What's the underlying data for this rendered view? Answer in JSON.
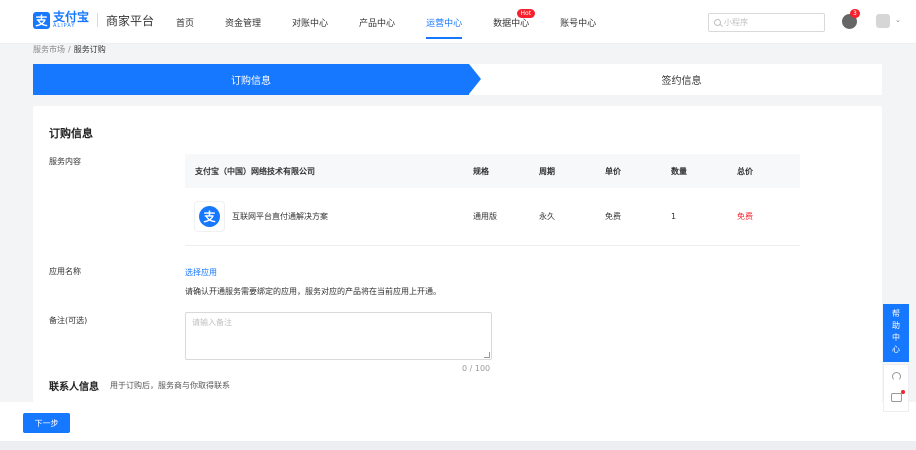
{
  "brand": {
    "logo_glyph": "支",
    "name_cn": "支付宝",
    "name_en": "ALIPAY",
    "platform": "商家平台",
    "accent_color": "#1677ff"
  },
  "nav": {
    "items": [
      {
        "label": "首页"
      },
      {
        "label": "资金管理"
      },
      {
        "label": "对账中心"
      },
      {
        "label": "产品中心"
      },
      {
        "label": "运营中心",
        "active": true
      },
      {
        "label": "数据中心",
        "badge": "Hot"
      },
      {
        "label": "账号中心"
      }
    ]
  },
  "header": {
    "search_placeholder": "小程序",
    "notification_count": "3"
  },
  "breadcrumb": {
    "parent": "服务市场",
    "separator": "/",
    "current": "服务订购"
  },
  "steps": {
    "active": "订购信息",
    "next": "签约信息"
  },
  "form": {
    "section_title": "订购信息",
    "service_label": "服务内容",
    "table": {
      "headers": [
        "支付宝（中国）网络技术有限公司",
        "规格",
        "周期",
        "单价",
        "数量",
        "总价"
      ],
      "row": {
        "icon_glyph": "支",
        "name": "互联网平台直付通解决方案",
        "spec": "通用版",
        "period": "永久",
        "unit_price": "免费",
        "quantity": "1",
        "total": "免费"
      }
    },
    "app_label": "应用名称",
    "select_app_link": "选择应用",
    "app_hint": "请确认开通服务需要绑定的应用，服务对应的产品将在当前应用上开通。",
    "remark_label": "备注(可选)",
    "remark_placeholder": "请输入备注",
    "remark_counter": "0 / 100",
    "contact_title": "联系人信息",
    "contact_subtitle": "用于订购后，服务商与你取得联系"
  },
  "footer": {
    "next_button": "下一步"
  },
  "side": {
    "help_chars": [
      "帮",
      "助",
      "中",
      "心"
    ]
  }
}
